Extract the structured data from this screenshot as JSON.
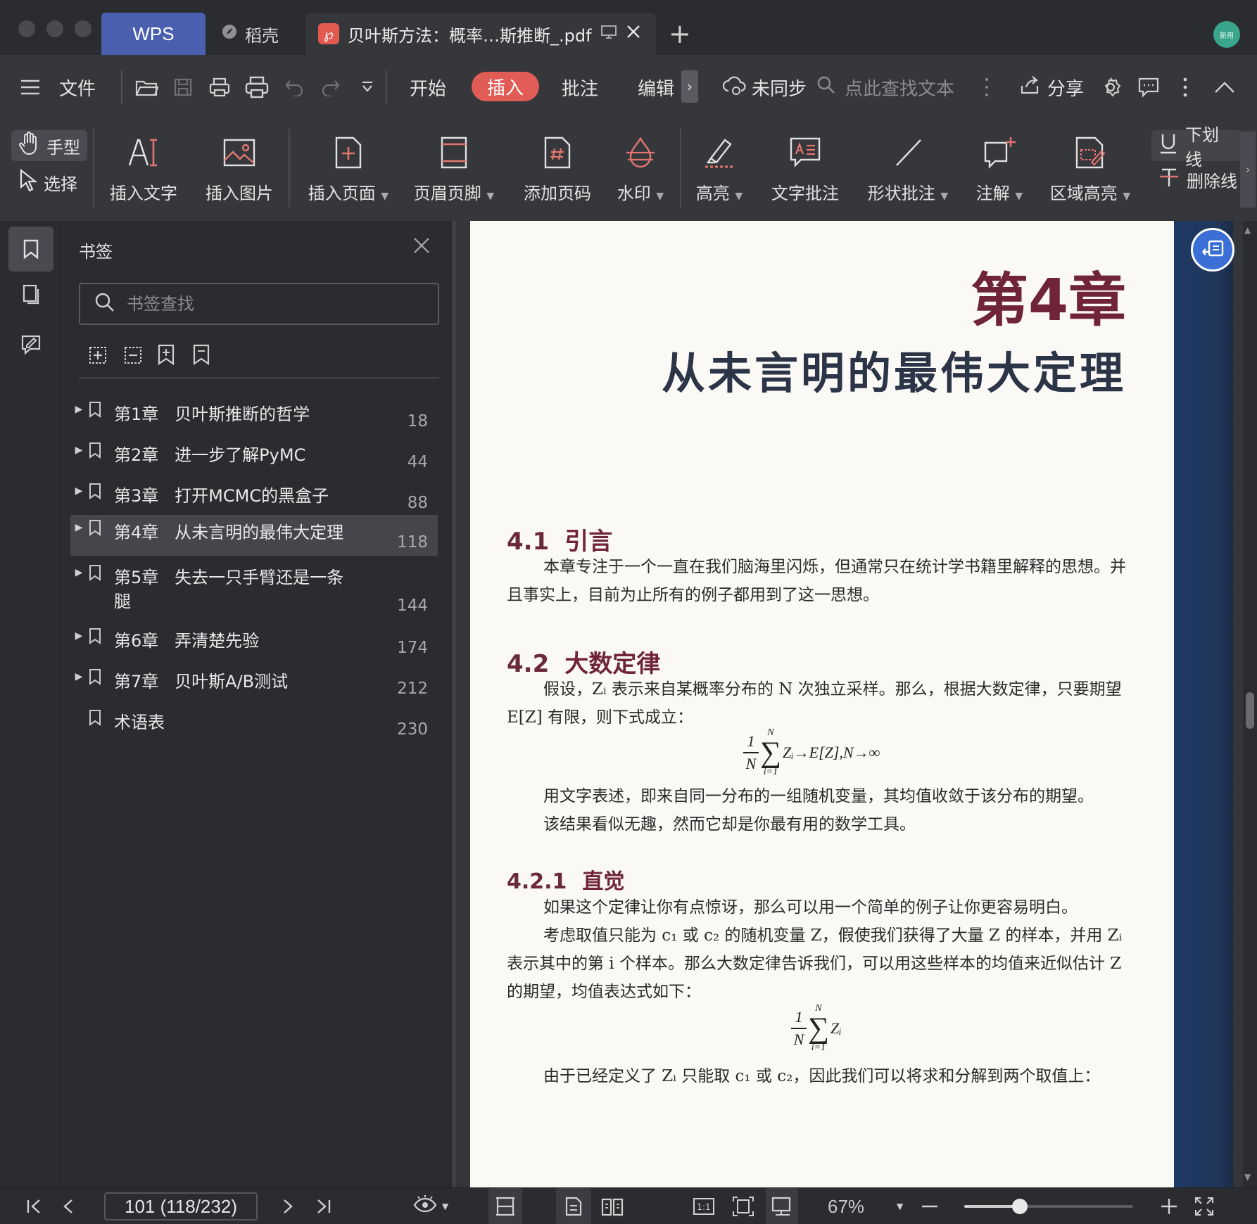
{
  "tabs": {
    "wps": "WPS",
    "daoke": "稻壳",
    "document": "贝叶斯方法：概率…斯推断_.pdf",
    "avatar_text": "新用"
  },
  "menu": {
    "file": "文件",
    "start": "开始",
    "insert": "插入",
    "annotate": "批注",
    "edit": "编辑",
    "sync": "未同步",
    "search_placeholder": "点此查找文本",
    "share": "分享"
  },
  "ribbon": {
    "hand_mode": "手型",
    "select_mode": "选择",
    "insert_text": "插入文字",
    "insert_image": "插入图片",
    "insert_page": "插入页面",
    "header_footer": "页眉页脚",
    "add_page_number": "添加页码",
    "watermark": "水印",
    "highlight": "高亮",
    "text_annotation": "文字批注",
    "shape_annotation": "形状批注",
    "note": "注解",
    "area_highlight": "区域高亮",
    "underline": "下划线",
    "strikethrough": "删除线"
  },
  "bookmarks": {
    "title": "书签",
    "search_placeholder": "书签查找",
    "items": [
      {
        "label": "第1章   贝叶斯推断的哲学",
        "page": "18"
      },
      {
        "label": "第2章   进一步了解PyMC",
        "page": "44"
      },
      {
        "label": "第3章   打开MCMC的黑盒子",
        "page": "88"
      },
      {
        "label": "第4章   从未言明的最伟大定理",
        "page": "118"
      },
      {
        "label": "第5章   失去一只手臂还是一条\n腿",
        "page": "144"
      },
      {
        "label": "第6章   弄清楚先验",
        "page": "174"
      },
      {
        "label": "第7章   贝叶斯A/B测试",
        "page": "212"
      },
      {
        "label": "术语表",
        "page": "230"
      }
    ]
  },
  "page_content": {
    "chapter_number": "第4章",
    "chapter_title": "从未言明的最伟大定理",
    "s41_num": "4.1",
    "s41_title": "引言",
    "s41_para": "本章专注于一个一直在我们脑海里闪烁，但通常只在统计学书籍里解释的思想。并且事实上，目前为止所有的例子都用到了这一思想。",
    "s42_num": "4.2",
    "s42_title": "大数定律",
    "s42_para1": "假设，Zᵢ 表示来自某概率分布的 N 次独立采样。那么，根据大数定律，只要期望 E[Z] 有限，则下式成立：",
    "formula1_tail": "Zᵢ→E[Z],N→∞",
    "s42_para2": "用文字表述，即来自同一分布的一组随机变量，其均值收敛于该分布的期望。",
    "s42_para3": "该结果看似无趣，然而它却是你最有用的数学工具。",
    "s421_num": "4.2.1",
    "s421_title": "直觉",
    "s421_para1": "如果这个定律让你有点惊讶，那么可以用一个简单的例子让你更容易明白。",
    "s421_para2": "考虑取值只能为 c₁ 或 c₂ 的随机变量 Z，假使我们获得了大量 Z 的样本，并用 Zᵢ 表示其中的第 i 个样本。那么大数定律告诉我们，可以用这些样本的均值来近似估计 Z 的期望，均值表达式如下：",
    "formula2_tail": "Zᵢ",
    "s421_para3": "由于已经定义了 Zᵢ 只能取 c₁ 或 c₂，因此我们可以将求和分解到两个取值上：",
    "frac_num": "1",
    "frac_den": "N",
    "sum_upper": "N",
    "sum_lower": "i=1",
    "sum_symbol": "∑"
  },
  "status": {
    "page_indicator": "101 (118/232)",
    "zoom": "67%",
    "zoom_fraction": 0.33
  }
}
